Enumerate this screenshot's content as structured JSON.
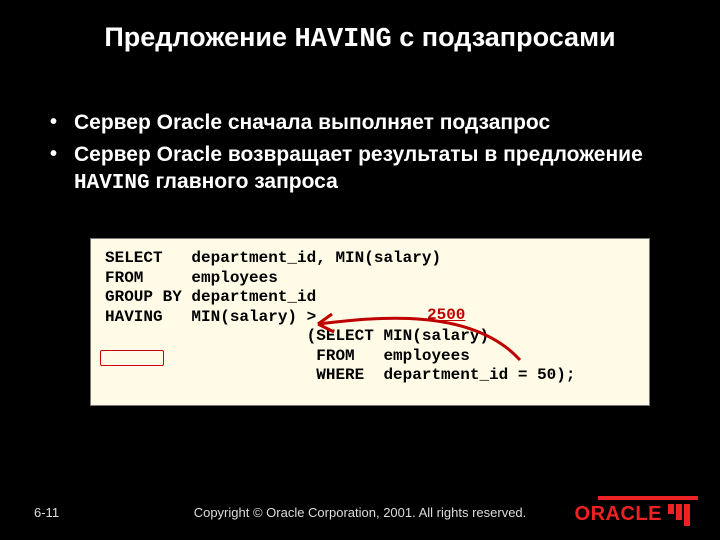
{
  "title": {
    "pre": "Предложение ",
    "mono": "HAVING",
    "post": " с подзапросами"
  },
  "bullets": [
    {
      "text_pre": "Сервер Oracle сначала выполняет подзапрос",
      "mono": "",
      "text_post": ""
    },
    {
      "text_pre": "Сервер Oracle возвращает результаты в предложение ",
      "mono": "HAVING",
      "text_post": " главного запроса"
    }
  ],
  "code": "SELECT   department_id, MIN(salary)\nFROM     employees\nGROUP BY department_id\nHAVING   MIN(salary) >\n                     (SELECT MIN(salary)\n                      FROM   employees\n                      WHERE  department_id = 50);",
  "annotation_value": "2500",
  "footer": {
    "slide_num": "6-11",
    "copyright": "Copyright © Oracle Corporation, 2001. All rights reserved."
  },
  "logo_text": "ORACLE",
  "colors": {
    "accent": "#e22",
    "code_bg": "#fffbe6",
    "annot": "#bf0000"
  }
}
